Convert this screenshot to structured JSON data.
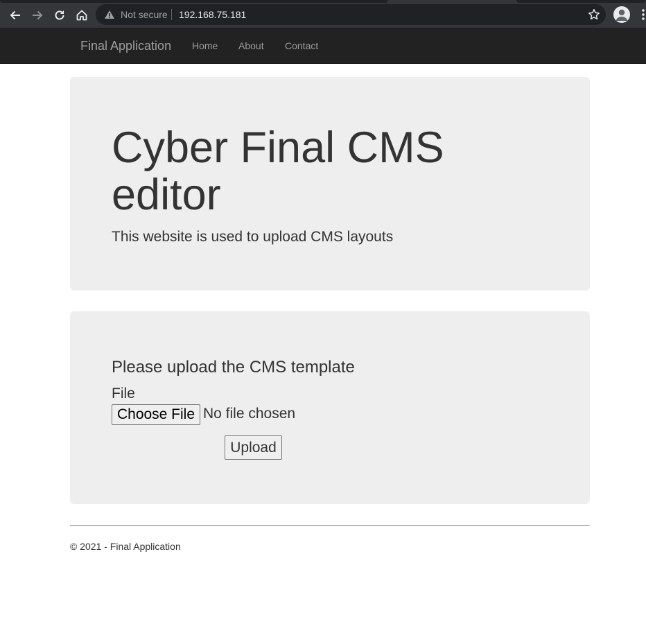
{
  "browser": {
    "security_label": "Not secure",
    "url": "192.168.75.181"
  },
  "navbar": {
    "brand": "Final Application",
    "links": [
      "Home",
      "About",
      "Contact"
    ]
  },
  "hero": {
    "title": "Cyber Final CMS editor",
    "lead": "This website is used to upload CMS layouts"
  },
  "upload": {
    "heading": "Please upload the CMS template",
    "file_label": "File",
    "choose_button": "Choose File",
    "file_status": "No file chosen",
    "submit_button": "Upload"
  },
  "footer": {
    "text": "© 2021 - Final Application"
  },
  "icons": [
    "back-icon",
    "forward-icon",
    "reload-icon",
    "home-icon",
    "warning-icon",
    "star-icon",
    "profile-icon",
    "menu-icon"
  ],
  "colors": {
    "browser_bar": "#35363a",
    "omnibox": "#202124",
    "navbar": "#222222",
    "nav_text": "#9d9d9d",
    "panel": "#eeeeee",
    "body_text": "#333333"
  }
}
